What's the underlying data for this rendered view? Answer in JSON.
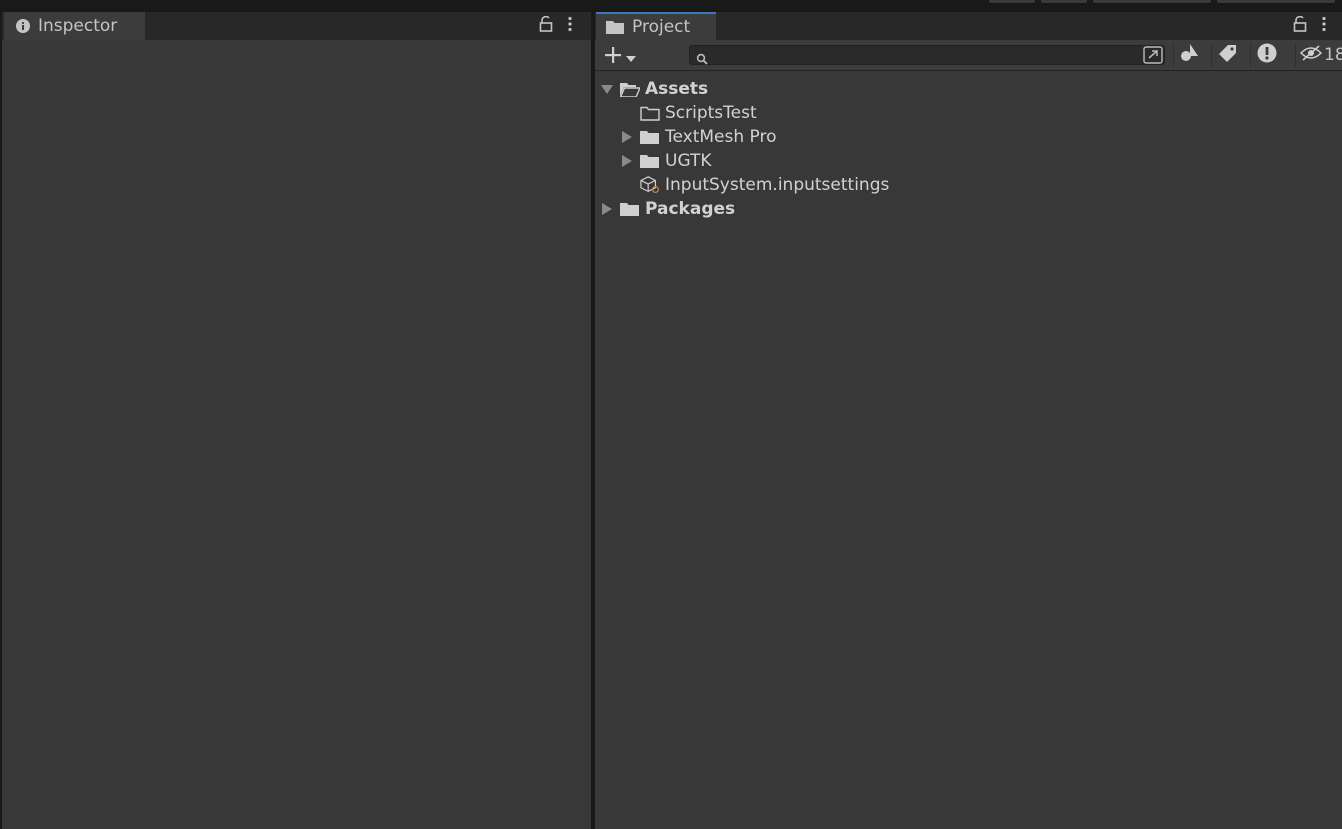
{
  "inspector": {
    "tab_label": "Inspector",
    "icons": [
      "info-icon",
      "lock-icon",
      "more-vertical-icon"
    ]
  },
  "project": {
    "tab_label": "Project",
    "toolbar": {
      "add_icon": "plus-icon",
      "search_value": "",
      "hidden_count": "18"
    },
    "tree": [
      {
        "label": "Assets",
        "expanded": true,
        "icon": "folder-open-icon"
      },
      {
        "label": "ScriptsTest",
        "icon": "folder-empty-icon"
      },
      {
        "label": "TextMesh Pro",
        "expanded": false,
        "icon": "folder-icon"
      },
      {
        "label": "UGTK",
        "expanded": false,
        "icon": "folder-icon"
      },
      {
        "label": "InputSystem.inputsettings",
        "icon": "input-settings-icon"
      },
      {
        "label": "Packages",
        "expanded": false,
        "icon": "folder-icon"
      }
    ]
  },
  "colors": {
    "panel_bg": "#383838",
    "tab_bg": "#3c3c3c",
    "active_tab_accent": "#3a79bb",
    "frame_bg": "#191919"
  }
}
